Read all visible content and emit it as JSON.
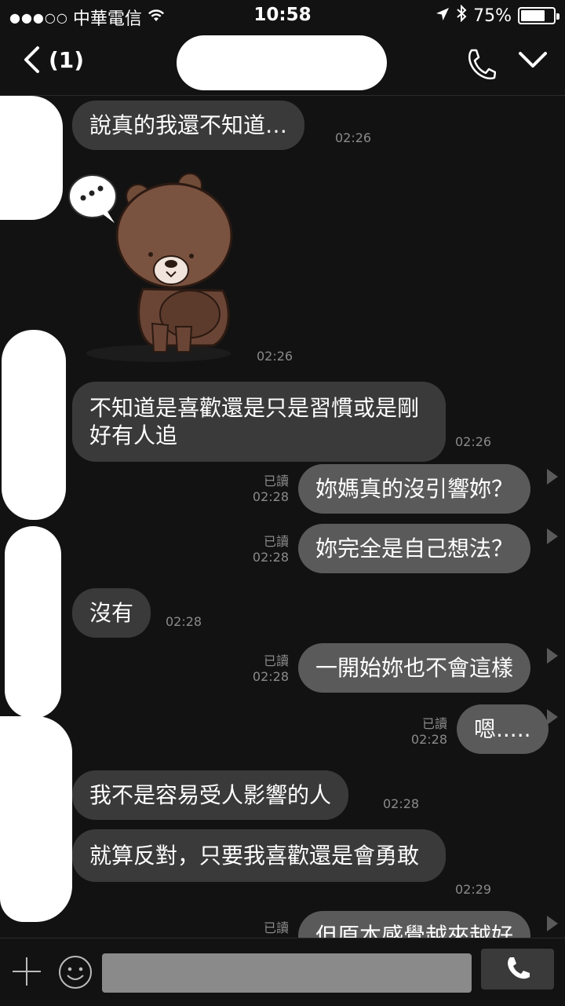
{
  "status_bar": {
    "signal_dots": "●●●○○",
    "carrier": "中華電信",
    "time": "10:58",
    "battery": "75%",
    "battery_level": 0.75
  },
  "nav": {
    "unread": "(1)"
  },
  "messages": [
    {
      "side": "recv",
      "text": "說真的我還不知道…",
      "time": "02:26"
    },
    {
      "side": "recv",
      "type": "sticker",
      "time": "02:26"
    },
    {
      "side": "recv",
      "text": "不知道是喜歡還是只是習慣或是剛好有人追",
      "time": "02:26"
    },
    {
      "side": "sent",
      "read": "已讀",
      "time": "02:28",
      "text": "妳媽真的沒引響妳？"
    },
    {
      "side": "sent",
      "read": "已讀",
      "time": "02:28",
      "text": "妳完全是自己想法？"
    },
    {
      "side": "recv",
      "text": "沒有",
      "time": "02:28"
    },
    {
      "side": "sent",
      "read": "已讀",
      "time": "02:28",
      "text": "一開始妳也不會這樣"
    },
    {
      "side": "sent",
      "read": "已讀",
      "time": "02:28",
      "text": "嗯....."
    },
    {
      "side": "recv",
      "text": "我不是容易受人影響的人",
      "time": "02:28"
    },
    {
      "side": "recv",
      "text": "就算反對，只要我喜歡還是會勇敢",
      "time": "02:29"
    },
    {
      "side": "sent",
      "read": "已讀",
      "text": "但原本感覺越來越好"
    }
  ],
  "colors": {
    "background": "#121212",
    "received_bubble": "#3a3a3a",
    "sent_bubble": "#5a5a5a",
    "meta_text": "#8a8a8a"
  }
}
